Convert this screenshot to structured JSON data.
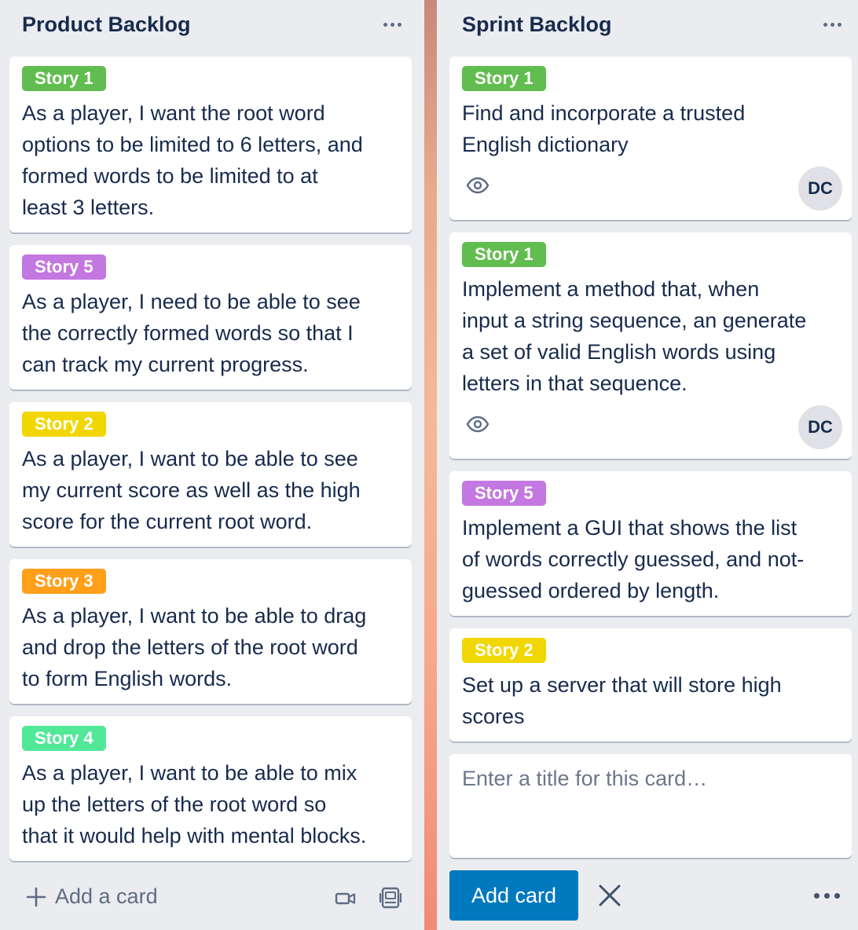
{
  "colors": {
    "label_green": "#61bd4f",
    "label_purple": "#c377e0",
    "label_yellow": "#f2d600",
    "label_orange": "#ff9f1a",
    "label_lime": "#51e898",
    "button_blue": "#0079bf"
  },
  "product_backlog": {
    "title": "Product Backlog",
    "menu_icon": "more-horizontal-icon",
    "cards": [
      {
        "label": "Story 1",
        "label_color": "#61bd4f",
        "text": "As a player, I want the root word\noptions to be limited to 6 letters, and\nformed words to be limited to at\nleast 3 letters."
      },
      {
        "label": "Story 5",
        "label_color": "#c377e0",
        "text": "As a player, I need to be able to see\nthe correctly formed words so that I\ncan track my current progress."
      },
      {
        "label": "Story 2",
        "label_color": "#f2d600",
        "text": "As a player, I want to be able to see\nmy current score as well as the high\nscore for the current root word."
      },
      {
        "label": "Story 3",
        "label_color": "#ff9f1a",
        "text": "As a player, I want to be able to drag\nand drop the letters of the root word\nto form English words."
      },
      {
        "label": "Story 4",
        "label_color": "#51e898",
        "text": "As a player, I want to be able to mix\nup the letters of the root word so\nthat it would help with mental blocks."
      }
    ],
    "add_card_label": "Add a card",
    "add_card_icon": "plus-icon",
    "record_icon": "video-icon",
    "template_icon": "card-template-icon"
  },
  "sprint_backlog": {
    "title": "Sprint Backlog",
    "menu_icon": "more-horizontal-icon",
    "cards": [
      {
        "label": "Story 1",
        "label_color": "#61bd4f",
        "text": "Find and incorporate a trusted\nEnglish dictionary",
        "watch_icon": "eye-icon",
        "member": "DC"
      },
      {
        "label": "Story 1",
        "label_color": "#61bd4f",
        "text": "Implement a method that, when\ninput a string sequence, an generate\na set of valid English words using\nletters in that sequence.",
        "watch_icon": "eye-icon",
        "member": "DC"
      },
      {
        "label": "Story 5",
        "label_color": "#c377e0",
        "text": "Implement a GUI that shows the list\nof words correctly guessed, and not-\nguessed ordered by length."
      },
      {
        "label": "Story 2",
        "label_color": "#f2d600",
        "text": "Set up a server that will store high\nscores"
      }
    ],
    "composer": {
      "placeholder": "Enter a title for this card…",
      "value": ""
    },
    "add_button_label": "Add card",
    "cancel_icon": "close-icon",
    "options_icon": "more-horizontal-icon"
  }
}
